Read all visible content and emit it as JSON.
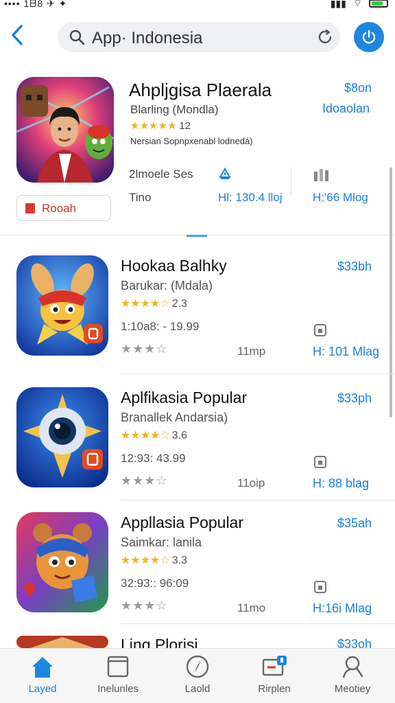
{
  "status_bar": {
    "left_text": "•••• 1ᗷ8 ✈ ✦",
    "battery_level": 0.6
  },
  "search": {
    "query": "App· Indonesia"
  },
  "featured": {
    "title": "Ahpljgisa Plaerala",
    "developer": "Blarling (Mondla)",
    "stars": "★★★★★",
    "rating": "12",
    "description": "Nersian Sopnpxenabl lodnedá)",
    "price": "$8on",
    "get_label": "Idoaolan",
    "meta_label1": "2lmoele Ses",
    "meta_label2": "Tino",
    "meta_value1": "Hl: 130.4 lloj",
    "meta_value2": "H:'66 Mlog",
    "button_label": "Rooah"
  },
  "apps": [
    {
      "name": "Hookaa Balhky",
      "developer": "Barukar: (Mdala)",
      "stars": "★★★★☆",
      "rating": "2.3",
      "size": "1:10a8: - 19.99",
      "secondary_stars": "★★★☆",
      "extra": "11mp",
      "price": "$33bh",
      "get_label": "H: 101 Mlag"
    },
    {
      "name": "Aplfikasia Popular",
      "developer": "Branallek Andarsia)",
      "stars": "★★★★☆",
      "rating": "3.6",
      "size": "12:93: 43.99",
      "secondary_stars": "★★★☆",
      "extra": "11oip",
      "price": "$33ph",
      "get_label": "H: 88 blag"
    },
    {
      "name": "Appllasia Popular",
      "developer": "Saimkar: lanila",
      "stars": "★★★★☆",
      "rating": "3.3",
      "size": "32:93:: 96:09",
      "secondary_stars": "★★★☆",
      "extra": "11mo",
      "price": "$35ah",
      "get_label": "H:16i Mlag"
    },
    {
      "name": "Ling Plorisi",
      "price": "$33oh"
    }
  ],
  "tabs": [
    {
      "label": "Layed",
      "icon": "home-icon",
      "active": true
    },
    {
      "label": "Inelunles",
      "icon": "apps-icon",
      "active": false
    },
    {
      "label": "Laold",
      "icon": "compass-icon",
      "active": false
    },
    {
      "label": "Rirplen",
      "icon": "updates-icon",
      "active": false
    },
    {
      "label": "Meotiey",
      "icon": "search-icon",
      "active": false
    }
  ],
  "colors": {
    "accent": "#1a7fe0",
    "star": "#f2b21c",
    "cta_red": "#c73323"
  }
}
